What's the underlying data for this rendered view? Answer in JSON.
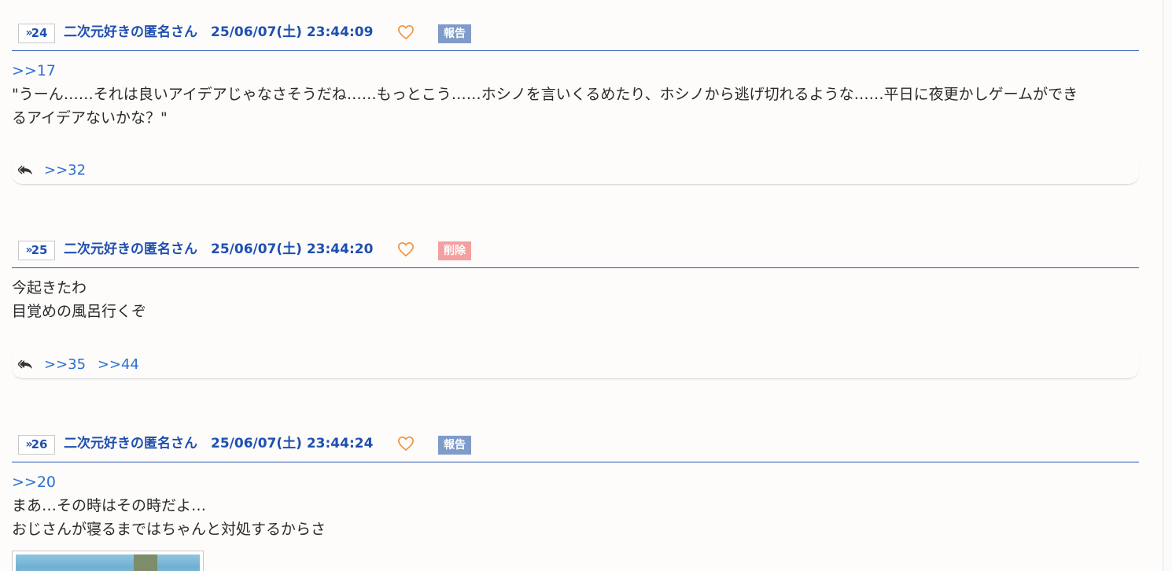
{
  "posts": [
    {
      "num": "24",
      "author": "二次元好きの匿名さん",
      "date": "25/06/07(土) 23:44:09",
      "badge": "報告",
      "badge_color": "#7f9bc9",
      "anchor": ">>17",
      "lines": [
        "\"うーん……それは良いアイデアじゃなさそうだね……もっとこう……ホシノを言いくるめたり、ホシノから逃げ切れるような……平日に夜更かしゲームができ",
        "るアイデアないかな？\""
      ],
      "replies": [
        ">>32"
      ]
    },
    {
      "num": "25",
      "author": "二次元好きの匿名さん",
      "date": "25/06/07(土) 23:44:20",
      "badge": "削除",
      "badge_color": "#f4a0a0",
      "anchor": "",
      "lines": [
        "今起きたわ",
        "目覚めの風呂行くぞ"
      ],
      "replies": [
        ">>35",
        ">>44"
      ]
    },
    {
      "num": "26",
      "author": "二次元好きの匿名さん",
      "date": "25/06/07(土) 23:44:24",
      "badge": "報告",
      "badge_color": "#7f9bc9",
      "anchor": ">>20",
      "lines": [
        "まあ…その時はその時だよ…",
        "おじさんが寝るまではちゃんと対処するからさ"
      ],
      "replies": []
    }
  ],
  "icons": {
    "number_prefix": "»",
    "heart": "heart-outline-icon",
    "reply": "reply-icon"
  },
  "colors": {
    "link_blue": "#2a6fd2",
    "header_blue": "#1f4fb0",
    "heart_orange": "#f0903a"
  }
}
